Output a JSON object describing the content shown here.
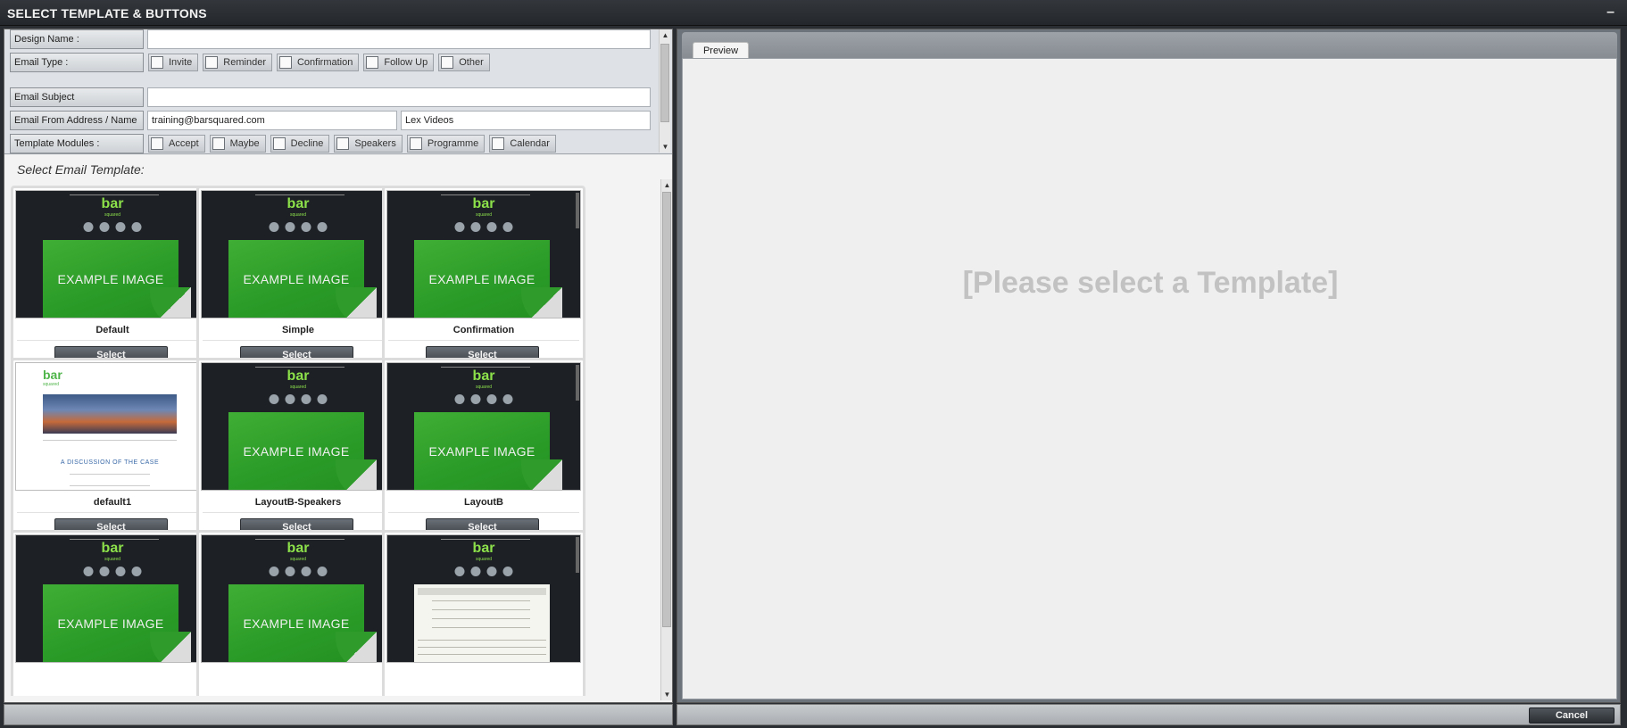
{
  "window": {
    "title": "SELECT TEMPLATE & BUTTONS",
    "minimize": "–"
  },
  "form": {
    "design_name_label": "Design Name :",
    "design_name_value": "",
    "email_type_label": "Email Type :",
    "email_types": [
      "Invite",
      "Reminder",
      "Confirmation",
      "Follow Up",
      "Other"
    ],
    "email_subject_label": "Email Subject",
    "email_subject_value": "",
    "from_label": "Email From Address / Name",
    "from_address": "training@barsquared.com",
    "from_name": "Lex Videos",
    "modules_label": "Template Modules :",
    "modules": [
      "Accept",
      "Maybe",
      "Decline",
      "Speakers",
      "Programme",
      "Calendar"
    ]
  },
  "templates": {
    "heading": "Select Email Template:",
    "example_text": "EXAMPLE IMAGE",
    "logo_text": "bar",
    "logo_sub": "squared",
    "light_heading": "A DISCUSSION OF THE CASE",
    "select_label": "Select",
    "items": [
      {
        "name": "Default"
      },
      {
        "name": "Simple"
      },
      {
        "name": "Confirmation"
      },
      {
        "name": "default1"
      },
      {
        "name": "LayoutB-Speakers"
      },
      {
        "name": "LayoutB"
      },
      {
        "name": ""
      },
      {
        "name": ""
      },
      {
        "name": ""
      }
    ]
  },
  "preview": {
    "tab_label": "Preview",
    "placeholder": "[Please select a Template]"
  },
  "footer": {
    "cancel_label": "Cancel"
  }
}
